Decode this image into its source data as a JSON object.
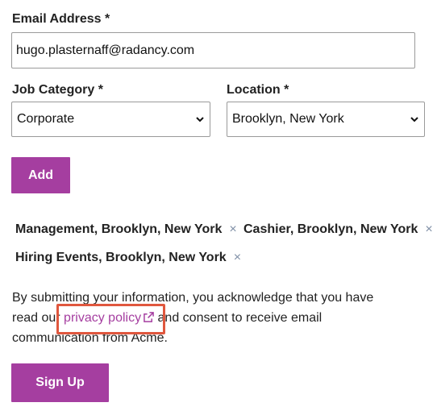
{
  "email": {
    "label": "Email Address *",
    "value": "hugo.plasternaff@radancy.com"
  },
  "job_category": {
    "label": "Job Category *",
    "selected": "Corporate"
  },
  "location": {
    "label": "Location *",
    "selected": "Brooklyn, New York"
  },
  "add_button": {
    "label": "Add"
  },
  "chips": [
    {
      "label": "Management, Brooklyn, New York",
      "remove": "×"
    },
    {
      "label": "Cashier, Brooklyn, New York",
      "remove": "×"
    },
    {
      "label": "Hiring Events, Brooklyn, New York",
      "remove": "×"
    }
  ],
  "consent": {
    "line1": "By submitting your information, you acknowledge that you have",
    "line2_prefix": "read our",
    "link_text": "privacy policy",
    "line2_suffix": "and consent to receive email",
    "line3": "communication from Acme."
  },
  "signup_button": {
    "label": "Sign Up"
  },
  "colors": {
    "accent": "#a53ea0",
    "highlight": "#e0573e",
    "remove_icon": "#7f8fa6"
  },
  "icons": {
    "select_arrow": "chevron-down-icon",
    "external_link": "external-link-icon",
    "remove": "close-icon"
  }
}
